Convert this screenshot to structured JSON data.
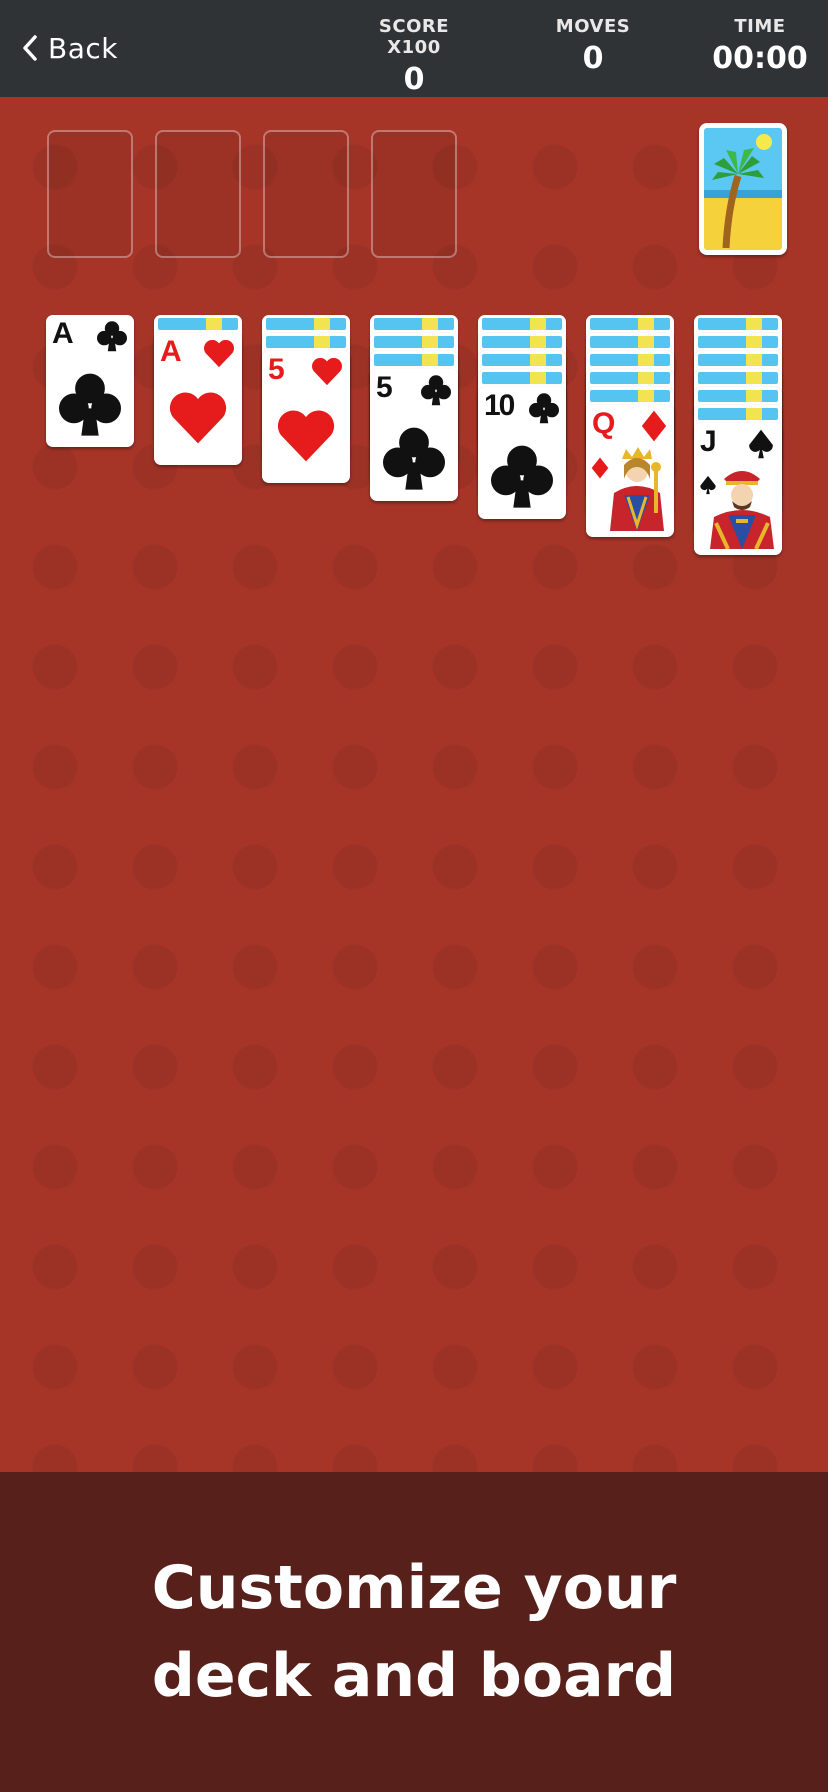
{
  "header": {
    "back_label": "Back",
    "score_label": "SCORE X100",
    "score_value": "0",
    "moves_label": "MOVES",
    "moves_value": "0",
    "time_label": "TIME",
    "time_value": "00:00"
  },
  "board": {
    "foundation_slots": 4,
    "stock": {
      "back_theme": "palm-beach-card-back"
    },
    "tableau": [
      {
        "face_down": 0,
        "top_card": {
          "rank": "A",
          "suit": "clubs",
          "color": "black"
        }
      },
      {
        "face_down": 1,
        "top_card": {
          "rank": "A",
          "suit": "hearts",
          "color": "red"
        }
      },
      {
        "face_down": 2,
        "top_card": {
          "rank": "5",
          "suit": "hearts",
          "color": "red"
        }
      },
      {
        "face_down": 3,
        "top_card": {
          "rank": "5",
          "suit": "clubs",
          "color": "black"
        }
      },
      {
        "face_down": 4,
        "top_card": {
          "rank": "10",
          "suit": "clubs",
          "color": "black"
        }
      },
      {
        "face_down": 5,
        "top_card": {
          "rank": "Q",
          "suit": "diamonds",
          "color": "red"
        }
      },
      {
        "face_down": 6,
        "top_card": {
          "rank": "J",
          "suit": "spades",
          "color": "black"
        }
      }
    ]
  },
  "promo": {
    "line1": "Customize your",
    "line2": "deck and board"
  },
  "colors": {
    "board": "#a63528",
    "header": "#2f3336",
    "promo": "#58201a",
    "red_suit": "#e61b1b"
  }
}
